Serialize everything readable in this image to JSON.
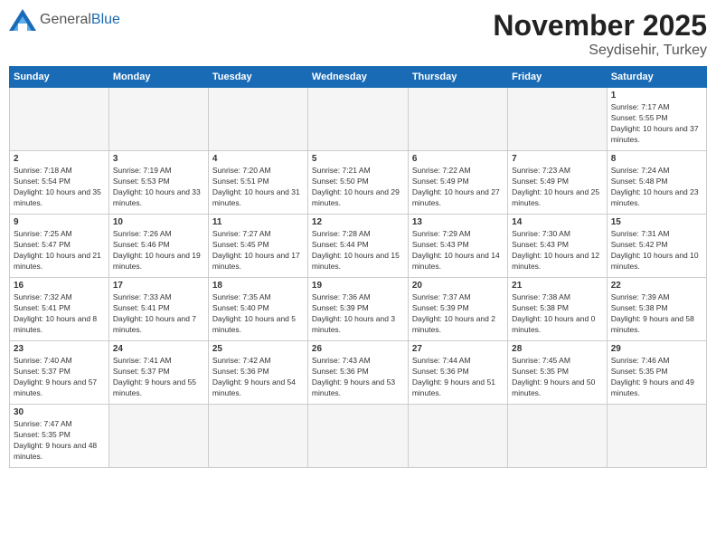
{
  "header": {
    "logo": {
      "general": "General",
      "blue": "Blue"
    },
    "title": "November 2025",
    "location": "Seydisehir, Turkey"
  },
  "days": [
    "Sunday",
    "Monday",
    "Tuesday",
    "Wednesday",
    "Thursday",
    "Friday",
    "Saturday"
  ],
  "weeks": [
    [
      {
        "day": "",
        "empty": true
      },
      {
        "day": "",
        "empty": true
      },
      {
        "day": "",
        "empty": true
      },
      {
        "day": "",
        "empty": true
      },
      {
        "day": "",
        "empty": true
      },
      {
        "day": "",
        "empty": true
      },
      {
        "day": "1",
        "sunrise": "Sunrise: 7:17 AM",
        "sunset": "Sunset: 5:55 PM",
        "daylight": "Daylight: 10 hours and 37 minutes."
      }
    ],
    [
      {
        "day": "2",
        "sunrise": "Sunrise: 7:18 AM",
        "sunset": "Sunset: 5:54 PM",
        "daylight": "Daylight: 10 hours and 35 minutes."
      },
      {
        "day": "3",
        "sunrise": "Sunrise: 7:19 AM",
        "sunset": "Sunset: 5:53 PM",
        "daylight": "Daylight: 10 hours and 33 minutes."
      },
      {
        "day": "4",
        "sunrise": "Sunrise: 7:20 AM",
        "sunset": "Sunset: 5:51 PM",
        "daylight": "Daylight: 10 hours and 31 minutes."
      },
      {
        "day": "5",
        "sunrise": "Sunrise: 7:21 AM",
        "sunset": "Sunset: 5:50 PM",
        "daylight": "Daylight: 10 hours and 29 minutes."
      },
      {
        "day": "6",
        "sunrise": "Sunrise: 7:22 AM",
        "sunset": "Sunset: 5:49 PM",
        "daylight": "Daylight: 10 hours and 27 minutes."
      },
      {
        "day": "7",
        "sunrise": "Sunrise: 7:23 AM",
        "sunset": "Sunset: 5:49 PM",
        "daylight": "Daylight: 10 hours and 25 minutes."
      },
      {
        "day": "8",
        "sunrise": "Sunrise: 7:24 AM",
        "sunset": "Sunset: 5:48 PM",
        "daylight": "Daylight: 10 hours and 23 minutes."
      }
    ],
    [
      {
        "day": "9",
        "sunrise": "Sunrise: 7:25 AM",
        "sunset": "Sunset: 5:47 PM",
        "daylight": "Daylight: 10 hours and 21 minutes."
      },
      {
        "day": "10",
        "sunrise": "Sunrise: 7:26 AM",
        "sunset": "Sunset: 5:46 PM",
        "daylight": "Daylight: 10 hours and 19 minutes."
      },
      {
        "day": "11",
        "sunrise": "Sunrise: 7:27 AM",
        "sunset": "Sunset: 5:45 PM",
        "daylight": "Daylight: 10 hours and 17 minutes."
      },
      {
        "day": "12",
        "sunrise": "Sunrise: 7:28 AM",
        "sunset": "Sunset: 5:44 PM",
        "daylight": "Daylight: 10 hours and 15 minutes."
      },
      {
        "day": "13",
        "sunrise": "Sunrise: 7:29 AM",
        "sunset": "Sunset: 5:43 PM",
        "daylight": "Daylight: 10 hours and 14 minutes."
      },
      {
        "day": "14",
        "sunrise": "Sunrise: 7:30 AM",
        "sunset": "Sunset: 5:43 PM",
        "daylight": "Daylight: 10 hours and 12 minutes."
      },
      {
        "day": "15",
        "sunrise": "Sunrise: 7:31 AM",
        "sunset": "Sunset: 5:42 PM",
        "daylight": "Daylight: 10 hours and 10 minutes."
      }
    ],
    [
      {
        "day": "16",
        "sunrise": "Sunrise: 7:32 AM",
        "sunset": "Sunset: 5:41 PM",
        "daylight": "Daylight: 10 hours and 8 minutes."
      },
      {
        "day": "17",
        "sunrise": "Sunrise: 7:33 AM",
        "sunset": "Sunset: 5:41 PM",
        "daylight": "Daylight: 10 hours and 7 minutes."
      },
      {
        "day": "18",
        "sunrise": "Sunrise: 7:35 AM",
        "sunset": "Sunset: 5:40 PM",
        "daylight": "Daylight: 10 hours and 5 minutes."
      },
      {
        "day": "19",
        "sunrise": "Sunrise: 7:36 AM",
        "sunset": "Sunset: 5:39 PM",
        "daylight": "Daylight: 10 hours and 3 minutes."
      },
      {
        "day": "20",
        "sunrise": "Sunrise: 7:37 AM",
        "sunset": "Sunset: 5:39 PM",
        "daylight": "Daylight: 10 hours and 2 minutes."
      },
      {
        "day": "21",
        "sunrise": "Sunrise: 7:38 AM",
        "sunset": "Sunset: 5:38 PM",
        "daylight": "Daylight: 10 hours and 0 minutes."
      },
      {
        "day": "22",
        "sunrise": "Sunrise: 7:39 AM",
        "sunset": "Sunset: 5:38 PM",
        "daylight": "Daylight: 9 hours and 58 minutes."
      }
    ],
    [
      {
        "day": "23",
        "sunrise": "Sunrise: 7:40 AM",
        "sunset": "Sunset: 5:37 PM",
        "daylight": "Daylight: 9 hours and 57 minutes."
      },
      {
        "day": "24",
        "sunrise": "Sunrise: 7:41 AM",
        "sunset": "Sunset: 5:37 PM",
        "daylight": "Daylight: 9 hours and 55 minutes."
      },
      {
        "day": "25",
        "sunrise": "Sunrise: 7:42 AM",
        "sunset": "Sunset: 5:36 PM",
        "daylight": "Daylight: 9 hours and 54 minutes."
      },
      {
        "day": "26",
        "sunrise": "Sunrise: 7:43 AM",
        "sunset": "Sunset: 5:36 PM",
        "daylight": "Daylight: 9 hours and 53 minutes."
      },
      {
        "day": "27",
        "sunrise": "Sunrise: 7:44 AM",
        "sunset": "Sunset: 5:36 PM",
        "daylight": "Daylight: 9 hours and 51 minutes."
      },
      {
        "day": "28",
        "sunrise": "Sunrise: 7:45 AM",
        "sunset": "Sunset: 5:35 PM",
        "daylight": "Daylight: 9 hours and 50 minutes."
      },
      {
        "day": "29",
        "sunrise": "Sunrise: 7:46 AM",
        "sunset": "Sunset: 5:35 PM",
        "daylight": "Daylight: 9 hours and 49 minutes."
      }
    ],
    [
      {
        "day": "30",
        "sunrise": "Sunrise: 7:47 AM",
        "sunset": "Sunset: 5:35 PM",
        "daylight": "Daylight: 9 hours and 48 minutes."
      },
      {
        "day": "",
        "empty": true
      },
      {
        "day": "",
        "empty": true
      },
      {
        "day": "",
        "empty": true
      },
      {
        "day": "",
        "empty": true
      },
      {
        "day": "",
        "empty": true
      },
      {
        "day": "",
        "empty": true
      }
    ]
  ]
}
